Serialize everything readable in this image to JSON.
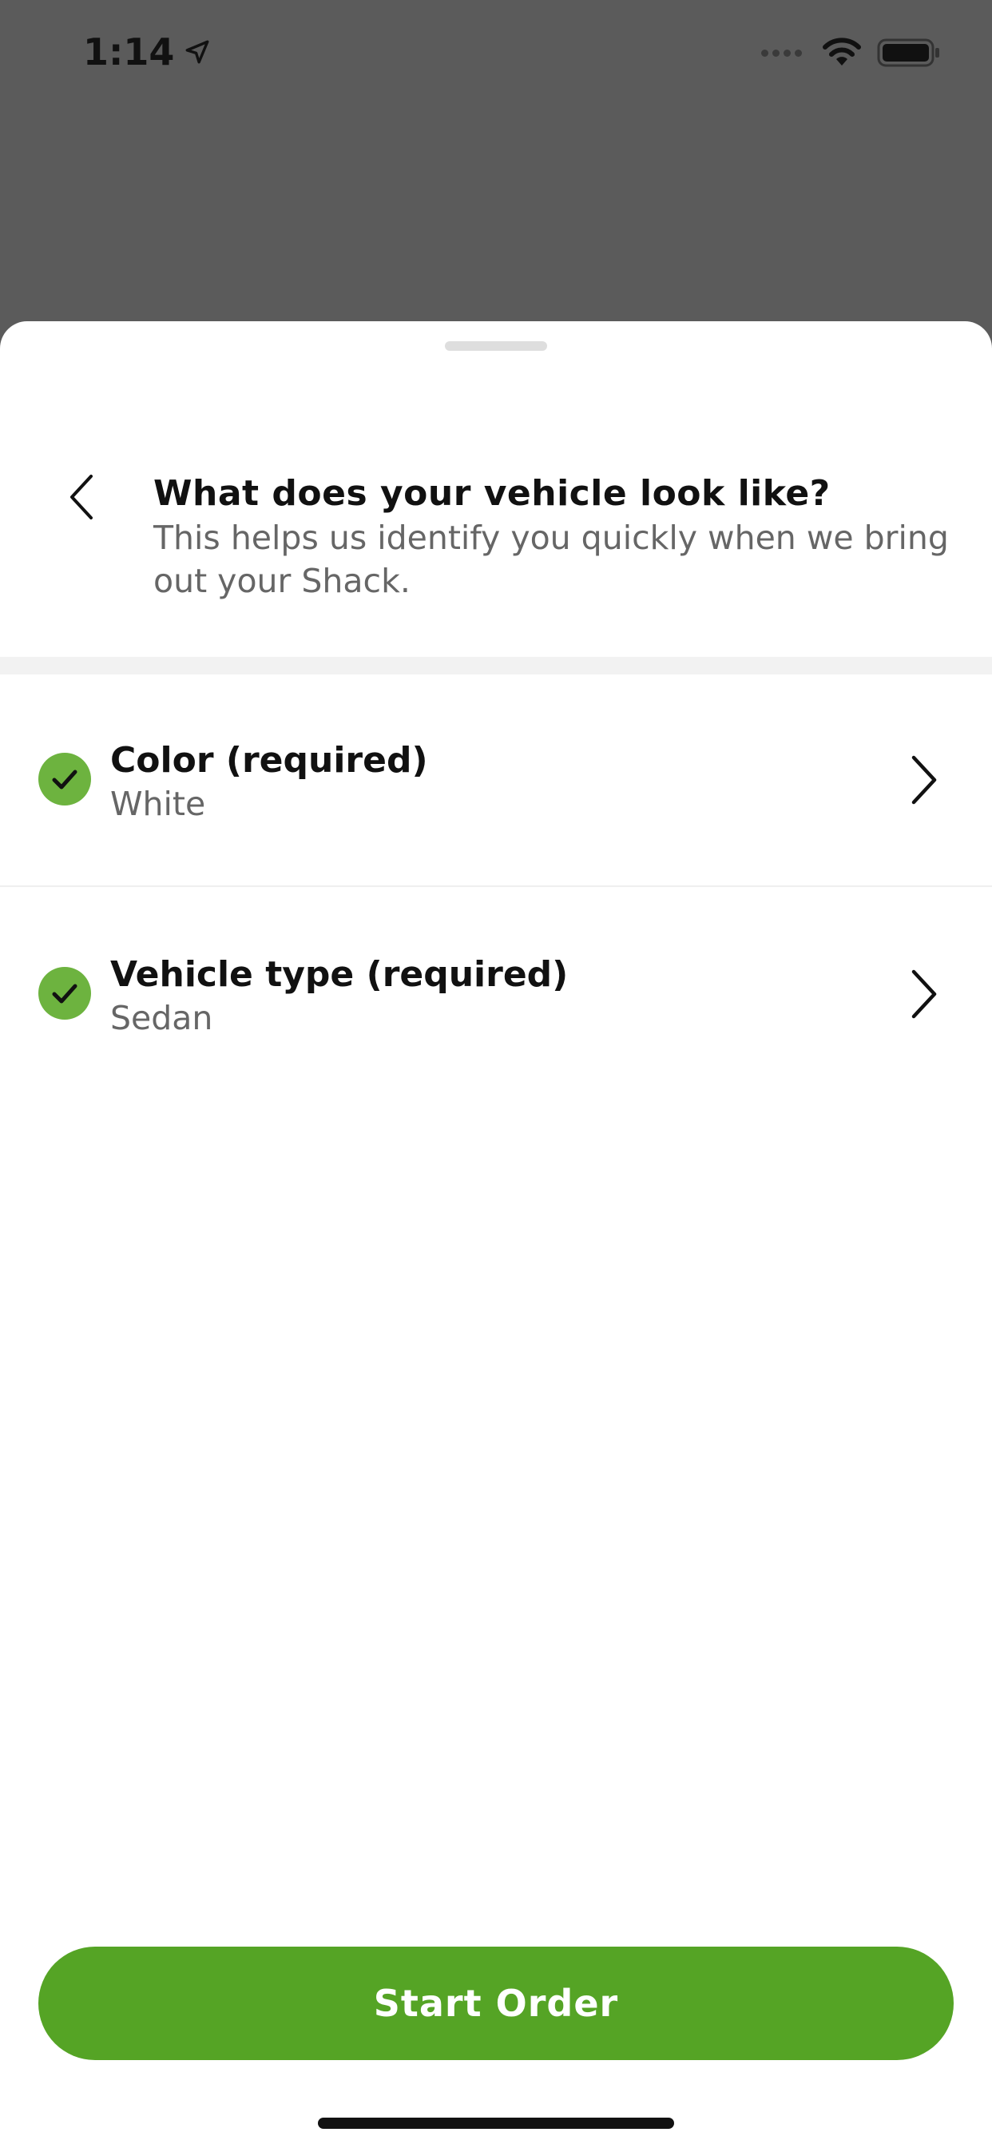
{
  "status_bar": {
    "time": "1:14",
    "icons": [
      "location-arrow-icon",
      "signal-icon",
      "wifi-icon",
      "battery-icon"
    ]
  },
  "header": {
    "title": "What does your vehicle look like?",
    "subtitle": "This helps us identify you quickly when we bring out your Shack.",
    "back_icon": "chevron-left-icon"
  },
  "rows": [
    {
      "label": "Color (required)",
      "value": "White",
      "status_icon": "check-circle-icon",
      "action_icon": "chevron-right-icon"
    },
    {
      "label": "Vehicle type (required)",
      "value": "Sedan",
      "status_icon": "check-circle-icon",
      "action_icon": "chevron-right-icon"
    }
  ],
  "footer": {
    "start_button_label": "Start Order"
  },
  "colors": {
    "overlay": "#5b5b5b",
    "accent_green": "#55a425",
    "check_green": "#6db33f",
    "text_primary": "#111111",
    "text_secondary": "#666666"
  }
}
